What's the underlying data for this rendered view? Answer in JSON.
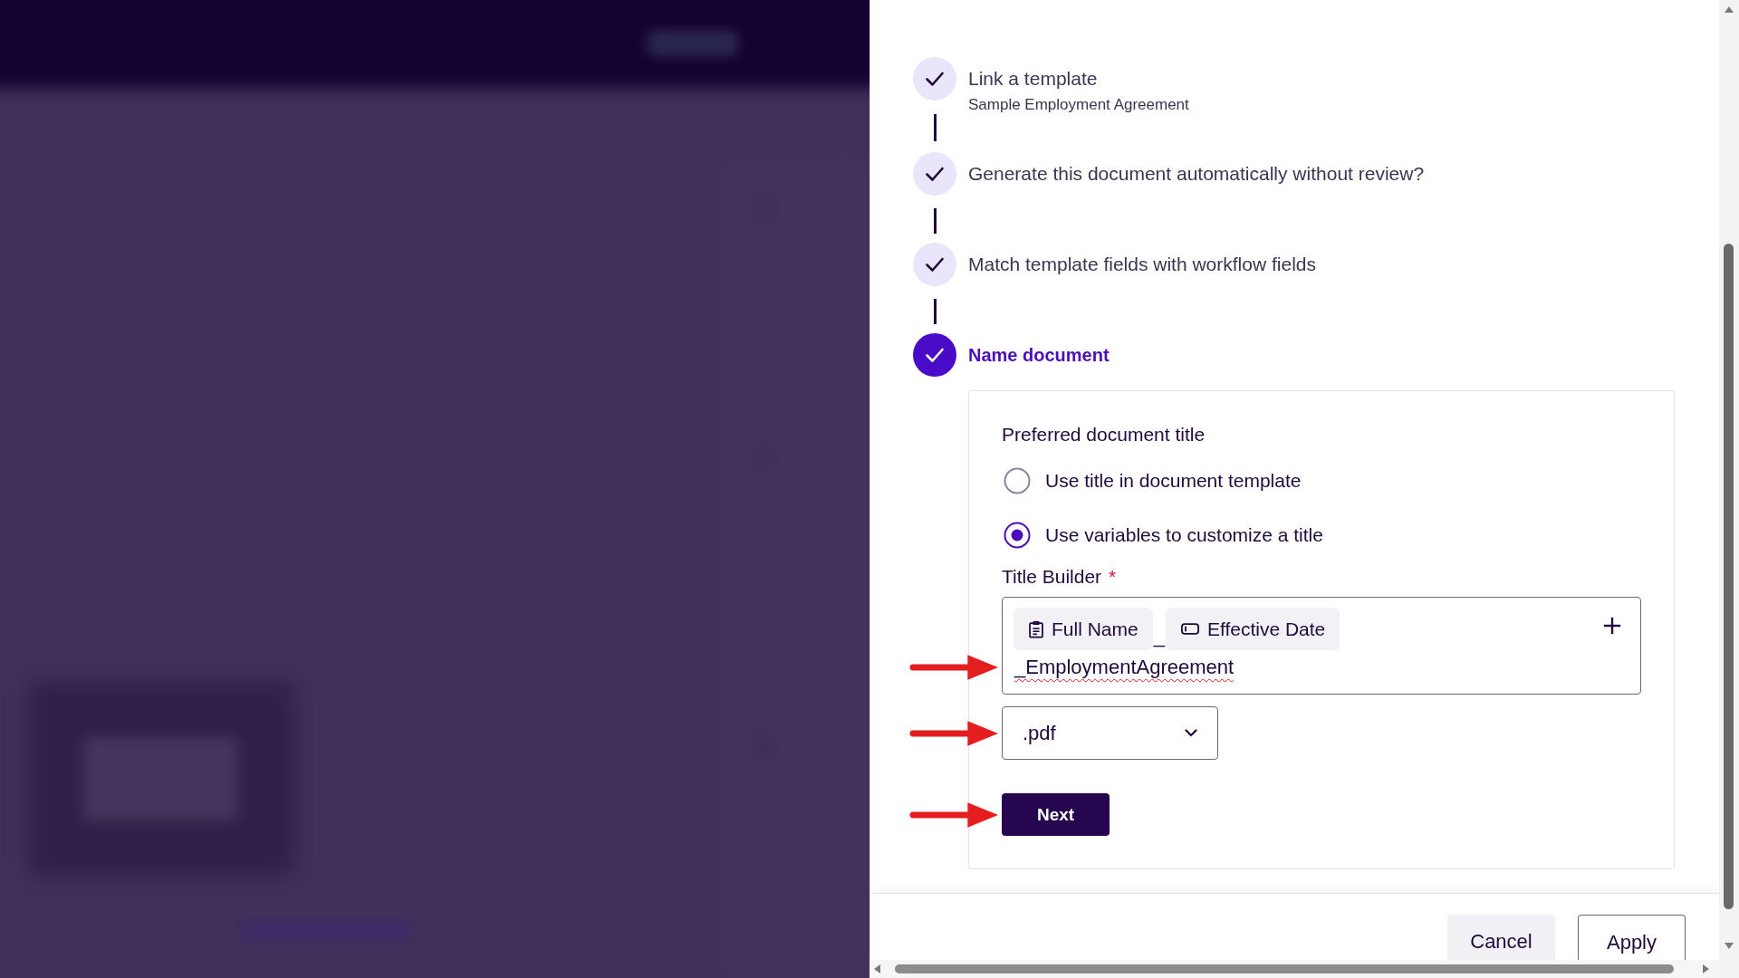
{
  "steps": [
    {
      "title": "Link a template",
      "subtitle": "Sample Employment Agreement",
      "completed": true,
      "selected": false
    },
    {
      "title": "Generate this document automatically without review?",
      "completed": true,
      "selected": false
    },
    {
      "title": "Match template fields with workflow fields",
      "completed": true,
      "selected": false
    },
    {
      "title": "Name document",
      "completed": true,
      "selected": true
    }
  ],
  "name_document": {
    "heading": "Preferred document title",
    "options": [
      {
        "label": "Use title in document template",
        "selected": false
      },
      {
        "label": "Use variables to customize a title",
        "selected": true
      }
    ],
    "title_builder": {
      "label": "Title Builder",
      "required_mark": "*",
      "tokens": [
        {
          "kind": "chip",
          "text": "Full Name",
          "annotated": false,
          "misspelled": false
        },
        {
          "kind": "text",
          "text": "_",
          "annotated": false,
          "misspelled": false
        },
        {
          "kind": "chip",
          "text": "Effective Date",
          "annotated": false,
          "misspelled": false
        },
        {
          "kind": "text",
          "text": "_EmploymentAgreement",
          "annotated": true,
          "misspelled": true
        }
      ]
    },
    "file_type": {
      "value": ".pdf",
      "annotated": true
    },
    "next_button": {
      "label": "Next",
      "annotated": true
    }
  },
  "footer": {
    "buttons": [
      {
        "label": "Cancel",
        "kind": "subtle"
      },
      {
        "label": "Apply",
        "kind": "outline"
      }
    ]
  }
}
